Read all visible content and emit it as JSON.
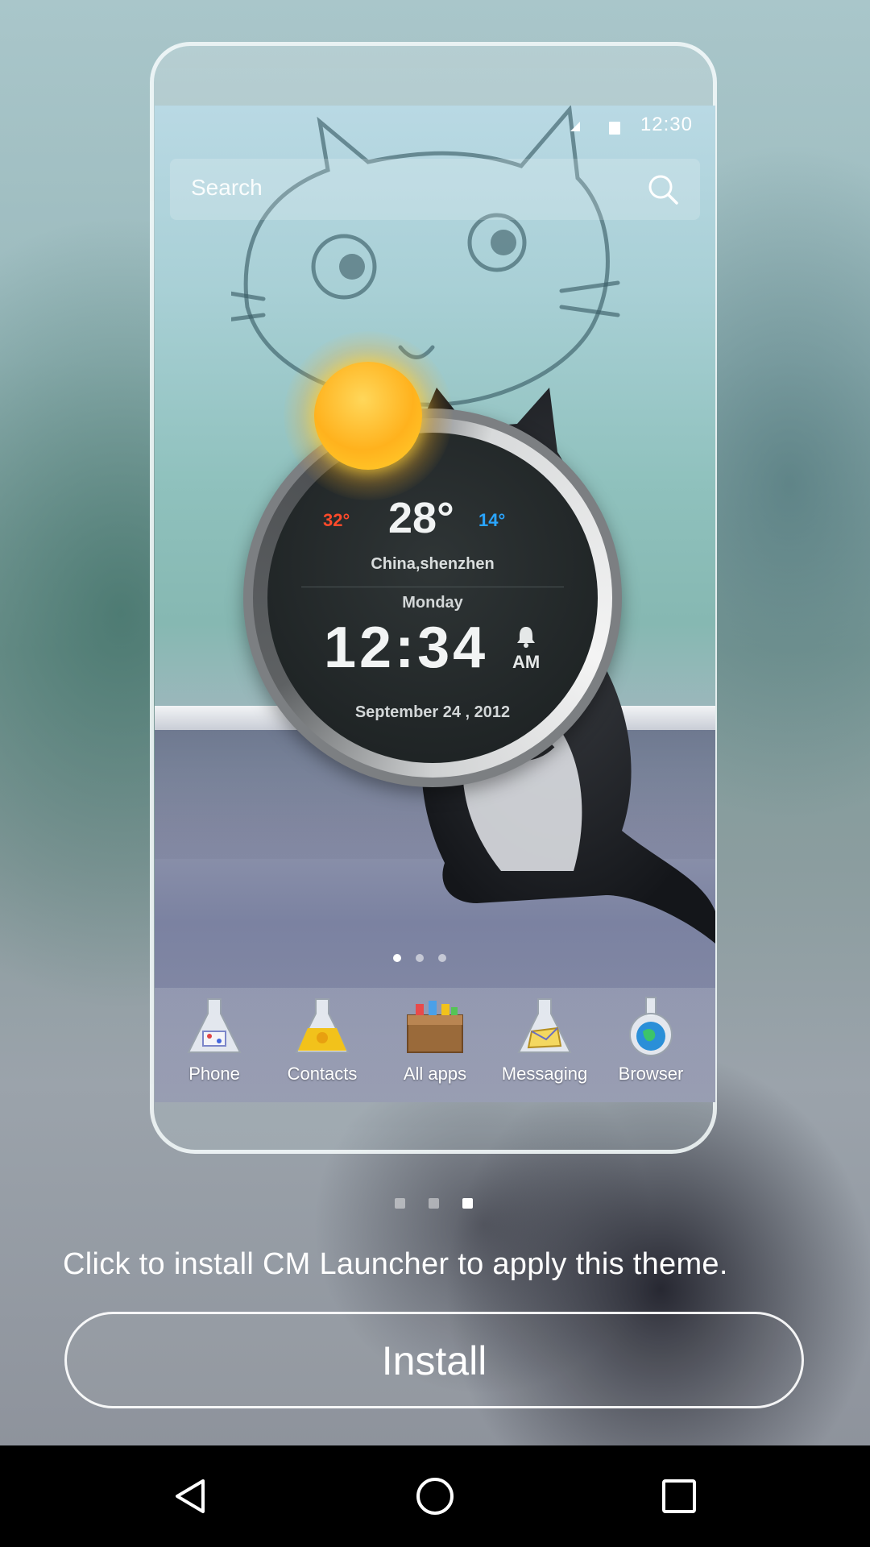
{
  "status_bar": {
    "time": "12:30"
  },
  "search": {
    "placeholder": "Search"
  },
  "weather": {
    "temp_current": "28°",
    "temp_low": "32°",
    "temp_high": "14°",
    "location": "China,shenzhen",
    "day": "Monday",
    "time": "12:34",
    "ampm": "AM",
    "date": "September 24 , 2012"
  },
  "dock": {
    "apps": [
      {
        "label": "Phone",
        "icon": "phone-flask-icon"
      },
      {
        "label": "Contacts",
        "icon": "contacts-flask-icon"
      },
      {
        "label": "All apps",
        "icon": "all-apps-box-icon"
      },
      {
        "label": "Messaging",
        "icon": "messaging-flask-icon"
      },
      {
        "label": "Browser",
        "icon": "browser-flask-icon"
      }
    ]
  },
  "pager": {
    "count": 3,
    "active_index": 2
  },
  "install": {
    "message": "Click to install CM Launcher to apply this theme.",
    "button_label": "Install"
  },
  "nav": {
    "back": "back-icon",
    "home": "home-icon",
    "recents": "recents-icon"
  },
  "colors": {
    "temp_low": "#ff4a2a",
    "temp_high": "#2aa5ff",
    "sun": "#ffb21d"
  }
}
